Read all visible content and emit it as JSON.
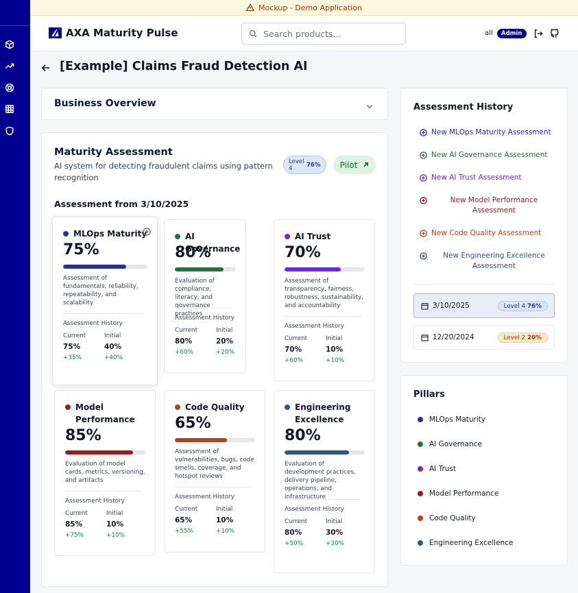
{
  "banner": {
    "text": "Mockup - Demo Application"
  },
  "sidebar": {
    "items": [
      "cube-icon",
      "trending-up-icon",
      "lifebuoy-icon",
      "grid-icon",
      "shield-icon"
    ]
  },
  "header": {
    "brand": "AXA Maturity Pulse",
    "search_placeholder": "Search products...",
    "user": "all",
    "role": "Admin"
  },
  "page": {
    "title": "[Example] Claims Fraud Detection AI"
  },
  "business_overview": {
    "title": "Business Overview"
  },
  "maturity": {
    "title": "Maturity Assessment",
    "description": "AI system for detecting fraudulent claims using pattern recognition",
    "level_label": "Level 4",
    "level_pct": "76%",
    "stage": "Pilot",
    "assessment_from": "Assessment from 3/10/2025"
  },
  "pillar_cards": [
    {
      "name": "MLOps Maturity",
      "color": "#2233a0",
      "pct_text": "75%",
      "pct": 75,
      "desc": "Assessment of fundamentals, reliability, repeatability, and scalability",
      "history_label": "Assessment History",
      "current_label": "Current",
      "initial_label": "Initial",
      "current": "75%",
      "initial": "40%",
      "current_delta": "+35%",
      "initial_delta": "+40%"
    },
    {
      "name": "AI Governance",
      "color": "#2f6b43",
      "pct_text": "80%",
      "pct": 80,
      "desc": "Evaluation of compliance, literacy, and governance practices",
      "history_label": "Assessment History",
      "current_label": "Current",
      "initial_label": "Initial",
      "current": "80%",
      "initial": "20%",
      "current_delta": "+60%",
      "initial_delta": "+20%"
    },
    {
      "name": "AI Trust",
      "color": "#6d28d9",
      "pct_text": "70%",
      "pct": 70,
      "desc": "Assessment of transparency, fairness, robustness, sustainability, and accountability",
      "history_label": "Assessment History",
      "current_label": "Current",
      "initial_label": "Initial",
      "current": "70%",
      "initial": "10%",
      "current_delta": "+60%",
      "initial_delta": "+10%"
    },
    {
      "name": "Model Performance",
      "color": "#9b1c1c",
      "pct_text": "85%",
      "pct": 85,
      "desc": "Evaluation of model cards, metrics, versioning, and artifacts",
      "history_label": "Assessment History",
      "current_label": "Current",
      "initial_label": "Initial",
      "current": "85%",
      "initial": "10%",
      "current_delta": "+75%",
      "initial_delta": "+10%"
    },
    {
      "name": "Code Quality",
      "color": "#b4431a",
      "pct_text": "65%",
      "pct": 65,
      "desc": "Assessment of vulnerabilities, bugs, code smells, coverage, and hotspot reviews",
      "history_label": "Assessment History",
      "current_label": "Current",
      "initial_label": "Initial",
      "current": "65%",
      "initial": "10%",
      "current_delta": "+55%",
      "initial_delta": "+10%"
    },
    {
      "name": "Engineering Excellence",
      "color": "#2d5688",
      "pct_text": "80%",
      "pct": 80,
      "desc": "Evaluation of development practices, delivery pipeline, operations, and infrastructure",
      "history_label": "Assessment History",
      "current_label": "Current",
      "initial_label": "Initial",
      "current": "80%",
      "initial": "30%",
      "current_delta": "+50%",
      "initial_delta": "+30%"
    }
  ],
  "assessment_history": {
    "title": "Assessment History",
    "new_links": [
      {
        "label": "New MLOps Maturity Assessment",
        "color": "#2233a0"
      },
      {
        "label": "New AI Governance Assessment",
        "color": "#2f6b43"
      },
      {
        "label": "New AI Trust Assessment",
        "color": "#6d28d9"
      },
      {
        "label": "New Model Performance Assessment",
        "color": "#9b1c1c"
      },
      {
        "label": "New Code Quality Assessment",
        "color": "#b4431a"
      },
      {
        "label": "New Engineering Excellence Assessment",
        "color": "#2d5688"
      }
    ],
    "dates": [
      {
        "date": "3/10/2025",
        "level": "Level 4",
        "pct": "76%",
        "selected": true
      },
      {
        "date": "12/20/2024",
        "level": "Level 2",
        "pct": "20%",
        "selected": false
      }
    ]
  },
  "pillars": {
    "title": "Pillars",
    "items": [
      {
        "label": "MLOps Maturity",
        "color": "#2233a0"
      },
      {
        "label": "AI Governance",
        "color": "#2f6b43"
      },
      {
        "label": "AI Trust",
        "color": "#6d28d9"
      },
      {
        "label": "Model Performance",
        "color": "#9b1c1c"
      },
      {
        "label": "Code Quality",
        "color": "#b4431a"
      },
      {
        "label": "Engineering Excellence",
        "color": "#2d5688"
      }
    ]
  }
}
